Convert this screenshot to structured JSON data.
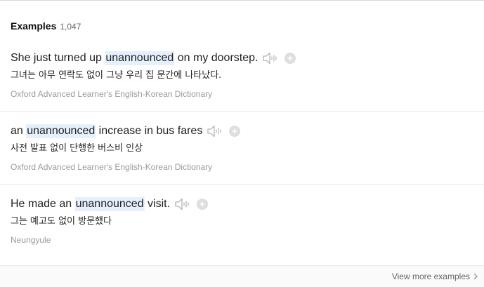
{
  "header": {
    "title": "Examples",
    "count": "1,047"
  },
  "examples": [
    {
      "before": "She just turned up ",
      "highlight": "unannounced",
      "after": " on my doorstep.",
      "translation": "그녀는 아무 연락도 없이 그냥 우리 집 문간에 나타났다.",
      "source": "Oxford Advanced Learner's English-Korean Dictionary"
    },
    {
      "before": "an ",
      "highlight": "unannounced",
      "after": " increase in bus fares",
      "translation": "사전 발표 없이 단행한 버스비 인상",
      "source": "Oxford Advanced Learner's English-Korean Dictionary"
    },
    {
      "before": "He made an ",
      "highlight": "unannounced",
      "after": " visit.",
      "translation": "그는 예고도 없이 방문했다",
      "source": "Neungyule"
    }
  ],
  "footer": {
    "view_more_label": "View more examples"
  },
  "icons": {
    "speaker": "speaker-icon",
    "add": "plus-icon",
    "chevron": "chevron-right-icon"
  },
  "colors": {
    "highlight": "#e6f0fc",
    "source_text": "#9a9a9a",
    "icon_gray": "#cfcfcf"
  }
}
